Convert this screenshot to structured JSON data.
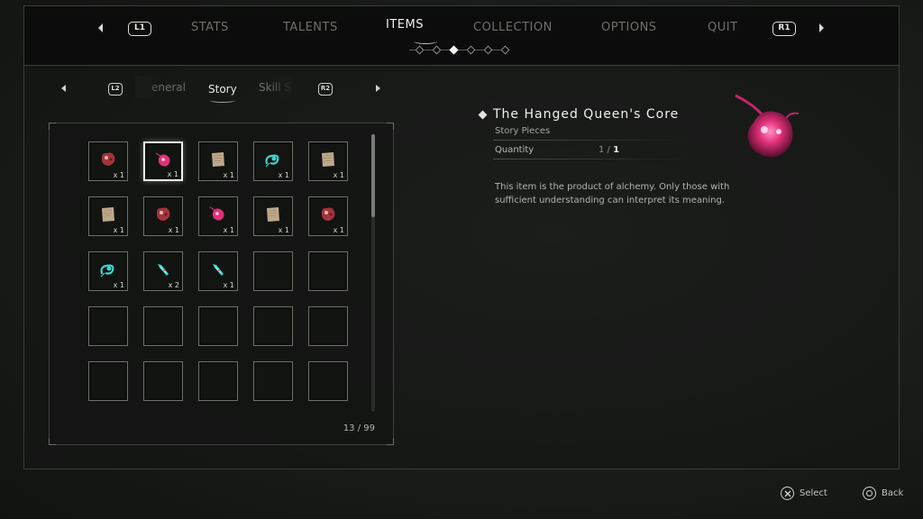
{
  "nav": {
    "left_badge": "L1",
    "right_badge": "R1",
    "tabs": [
      {
        "label": "STATS",
        "active": false
      },
      {
        "label": "TALENTS",
        "active": false
      },
      {
        "label": "ITEMS",
        "active": true
      },
      {
        "label": "COLLECTION",
        "active": false
      },
      {
        "label": "OPTIONS",
        "active": false
      },
      {
        "label": "QUIT",
        "active": false
      }
    ],
    "page_dots": {
      "count": 6,
      "active_index": 2
    }
  },
  "subnav": {
    "left_badge": "L2",
    "right_badge": "R2",
    "tabs": [
      {
        "label": "eneral",
        "active": false
      },
      {
        "label": "Story",
        "active": true
      },
      {
        "label": "Skill S",
        "active": false
      }
    ]
  },
  "inventory": {
    "count_text": "13 / 99",
    "scroll_position": 0.0,
    "slots": [
      {
        "icon": "red-heart-icon",
        "qty": "x 1",
        "selected": false
      },
      {
        "icon": "pink-core-icon",
        "qty": "x 1",
        "selected": true
      },
      {
        "icon": "paper-scroll-icon",
        "qty": "x 1",
        "selected": false
      },
      {
        "icon": "teal-ribbon-icon",
        "qty": "x 1",
        "selected": false
      },
      {
        "icon": "paper-scroll-icon",
        "qty": "x 1",
        "selected": false
      },
      {
        "icon": "paper-scroll-icon",
        "qty": "x 1",
        "selected": false
      },
      {
        "icon": "red-heart-icon",
        "qty": "x 1",
        "selected": false
      },
      {
        "icon": "pink-core-icon",
        "qty": "x 1",
        "selected": false
      },
      {
        "icon": "paper-scroll-icon",
        "qty": "x 1",
        "selected": false
      },
      {
        "icon": "red-heart-icon",
        "qty": "x 1",
        "selected": false
      },
      {
        "icon": "teal-ribbon-icon",
        "qty": "x 1",
        "selected": false
      },
      {
        "icon": "teal-crystal-icon",
        "qty": "x 2",
        "selected": false
      },
      {
        "icon": "teal-crystal-icon",
        "qty": "x 1",
        "selected": false
      },
      {
        "icon": "",
        "qty": "",
        "selected": false
      },
      {
        "icon": "",
        "qty": "",
        "selected": false
      },
      {
        "icon": "",
        "qty": "",
        "selected": false
      },
      {
        "icon": "",
        "qty": "",
        "selected": false
      },
      {
        "icon": "",
        "qty": "",
        "selected": false
      },
      {
        "icon": "",
        "qty": "",
        "selected": false
      },
      {
        "icon": "",
        "qty": "",
        "selected": false
      },
      {
        "icon": "",
        "qty": "",
        "selected": false
      },
      {
        "icon": "",
        "qty": "",
        "selected": false
      },
      {
        "icon": "",
        "qty": "",
        "selected": false
      },
      {
        "icon": "",
        "qty": "",
        "selected": false
      },
      {
        "icon": "",
        "qty": "",
        "selected": false
      }
    ]
  },
  "detail": {
    "title": "The Hanged Queen's Core",
    "category": "Story Pieces",
    "quantity_label": "Quantity",
    "quantity_owned": "1",
    "quantity_sep": " / ",
    "quantity_max": "1",
    "description": "This item is the product of alchemy. Only those with sufficient understanding can interpret its meaning.",
    "icon": "pink-core-icon"
  },
  "footer": {
    "select_label": "Select",
    "back_label": "Back"
  },
  "colors": {
    "pink": "#e0307a",
    "teal": "#3fd6d0",
    "paper": "#bfa88a",
    "red": "#a3343c"
  }
}
